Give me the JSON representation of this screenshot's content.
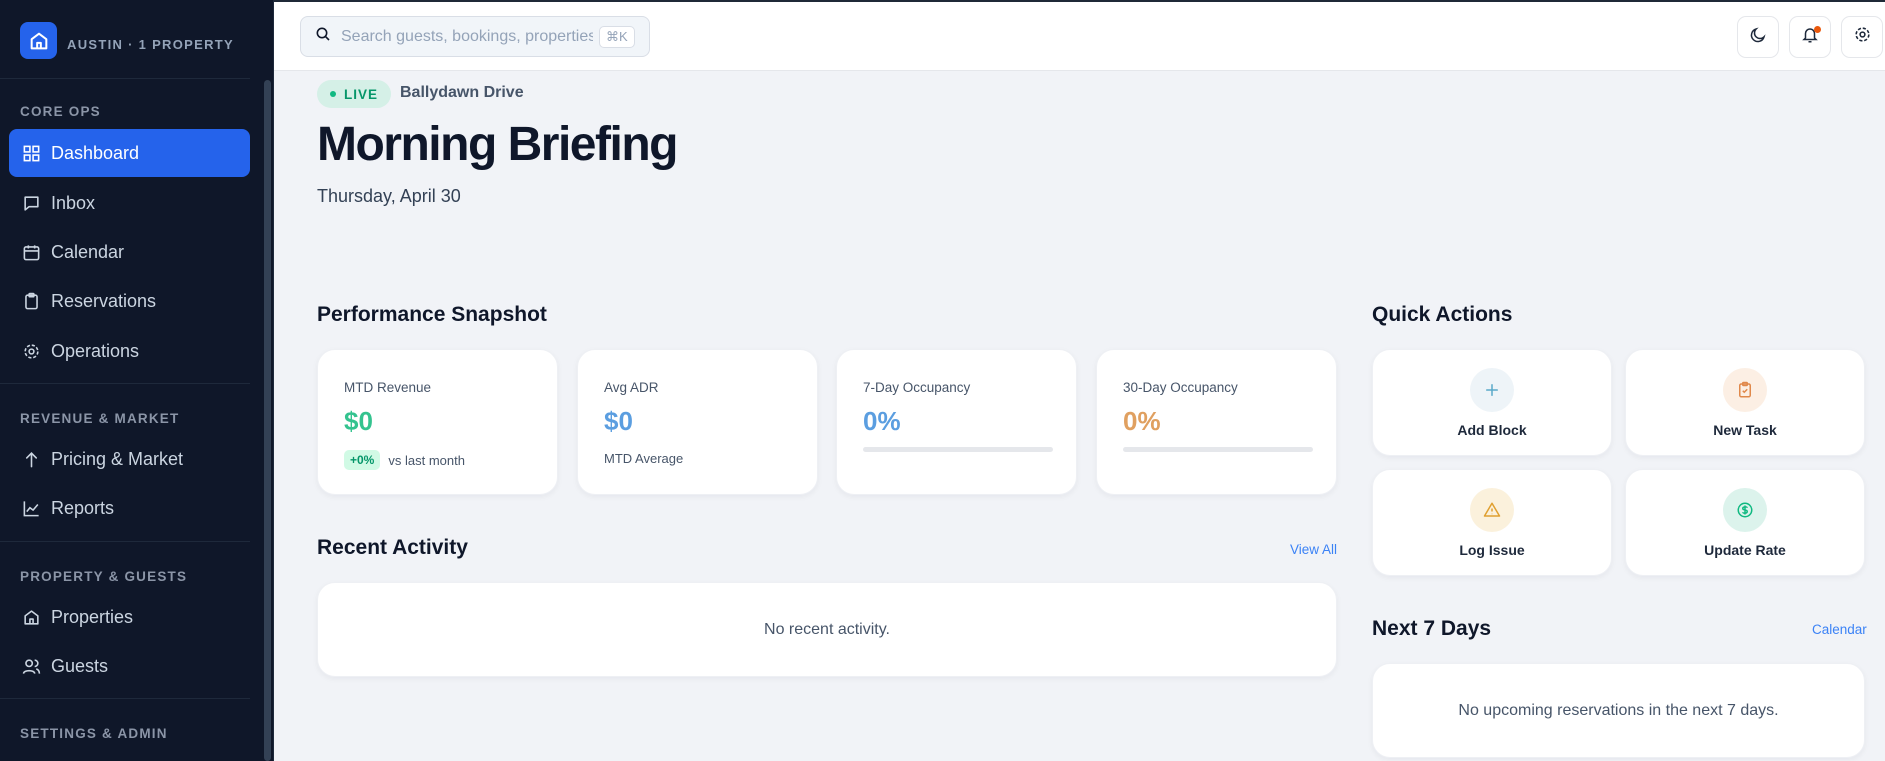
{
  "sidebar": {
    "brand": "AUSTIN · 1 PROPERTY",
    "sections": {
      "core_ops": "CORE OPS",
      "revenue": "REVENUE & MARKET",
      "property": "PROPERTY & GUESTS",
      "settings": "SETTINGS & ADMIN"
    },
    "items": [
      {
        "label": "Dashboard",
        "icon": "grid-icon",
        "active": true
      },
      {
        "label": "Inbox",
        "icon": "message-icon"
      },
      {
        "label": "Calendar",
        "icon": "calendar-icon"
      },
      {
        "label": "Reservations",
        "icon": "clipboard-icon"
      },
      {
        "label": "Operations",
        "icon": "gear-icon"
      },
      {
        "label": "Pricing & Market",
        "icon": "arrow-up-icon"
      },
      {
        "label": "Reports",
        "icon": "line-chart-icon"
      },
      {
        "label": "Properties",
        "icon": "home-icon"
      },
      {
        "label": "Guests",
        "icon": "users-icon"
      }
    ]
  },
  "topbar": {
    "search_placeholder": "Search guests, bookings, properties...",
    "shortcut": "⌘K"
  },
  "header": {
    "live": "LIVE",
    "property": "Ballydawn Drive",
    "title": "Morning Briefing",
    "date": "Thursday, April 30"
  },
  "performance": {
    "title": "Performance Snapshot",
    "cards": [
      {
        "label": "MTD Revenue",
        "value": "$0",
        "badge": "+0%",
        "sub": "vs last month",
        "color": "#34c38f"
      },
      {
        "label": "Avg ADR",
        "value": "$0",
        "sub": "MTD Average",
        "color": "#5b9ee0"
      },
      {
        "label": "7-Day Occupancy",
        "value": "0%",
        "progress": 0,
        "color": "#5b9ee0"
      },
      {
        "label": "30-Day Occupancy",
        "value": "0%",
        "progress": 0,
        "color": "#e0a060"
      }
    ]
  },
  "recent": {
    "title": "Recent Activity",
    "link": "View All",
    "empty": "No recent activity."
  },
  "quick_actions": {
    "title": "Quick Actions",
    "items": [
      {
        "label": "Add Block",
        "icon": "plus-icon",
        "color": "#5aa9c9",
        "bg": "#eef4f8"
      },
      {
        "label": "New Task",
        "icon": "clipboard-check-icon",
        "color": "#e0884a",
        "bg": "#fcefe4"
      },
      {
        "label": "Log Issue",
        "icon": "warning-icon",
        "color": "#e0a030",
        "bg": "#fbf1dc"
      },
      {
        "label": "Update Rate",
        "icon": "dollar-icon",
        "color": "#10b981",
        "bg": "#dcf3ec"
      }
    ]
  },
  "next7": {
    "title": "Next 7 Days",
    "link": "Calendar",
    "empty": "No upcoming reservations in the next 7 days."
  }
}
